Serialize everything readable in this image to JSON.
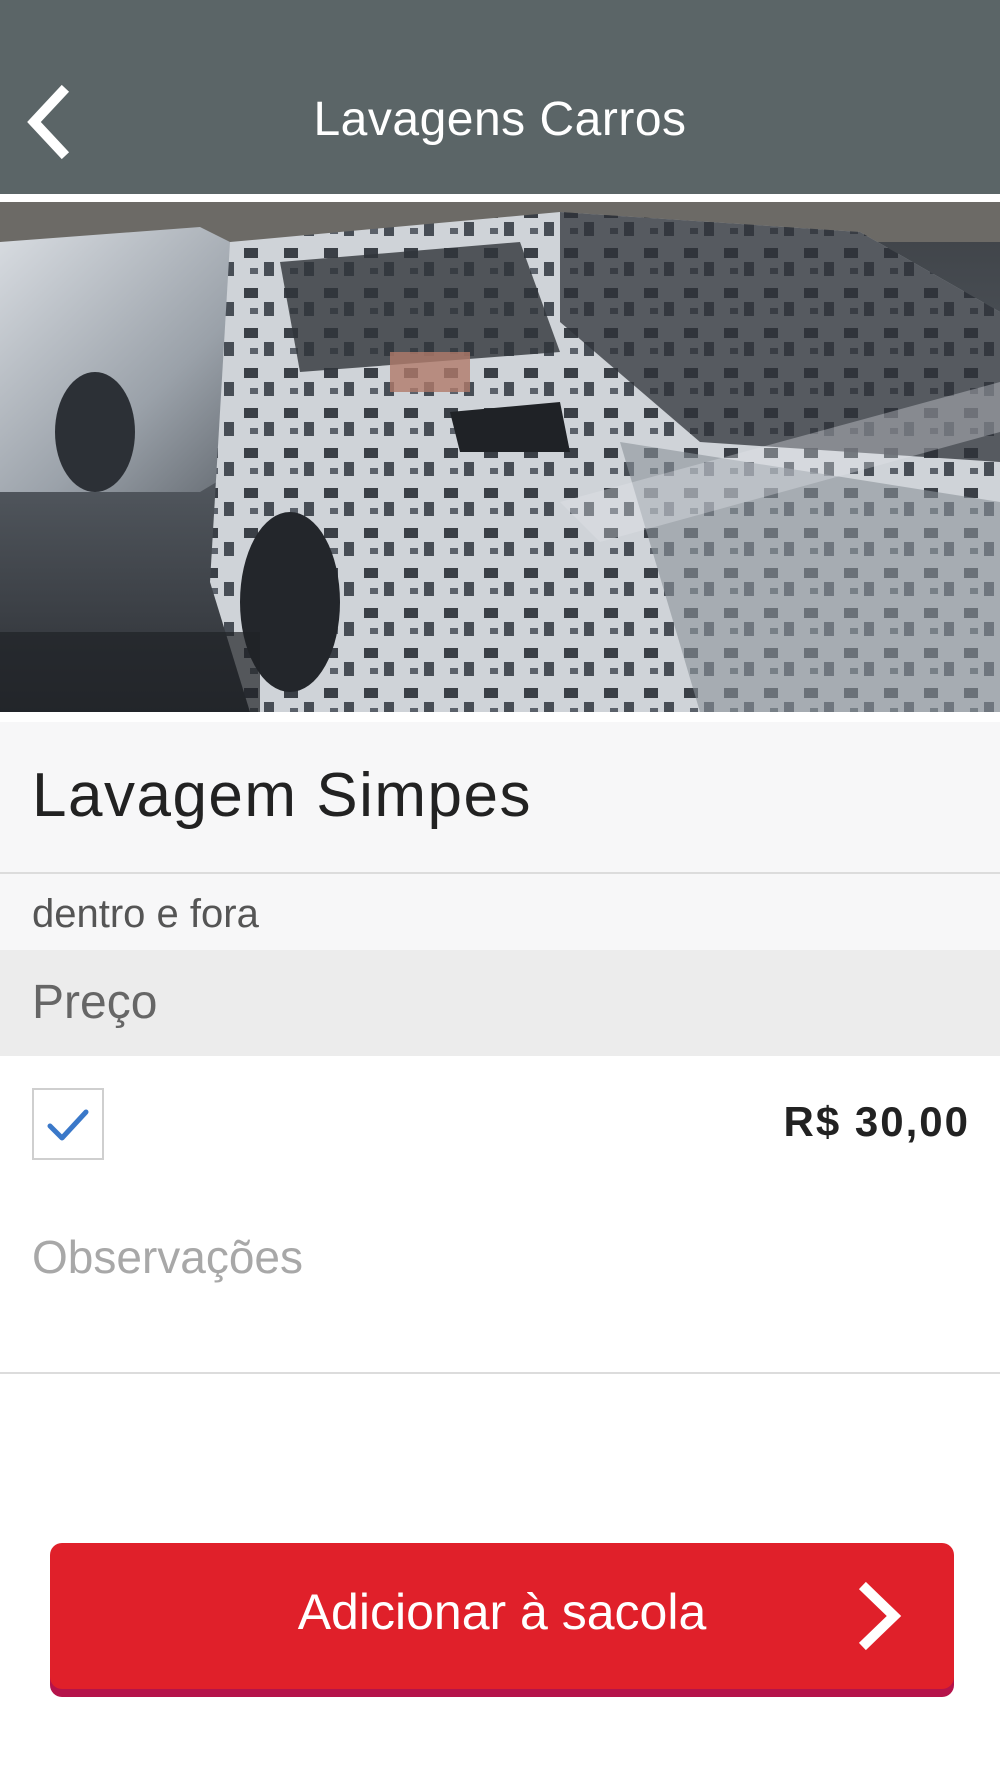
{
  "header": {
    "title": "Lavagens Carros",
    "back_icon": "chevron-left-icon"
  },
  "hero": {
    "image": "foam-covered-cars-photo"
  },
  "product": {
    "title": "Lavagem Simpes",
    "description": "dentro e fora"
  },
  "price_section": {
    "label": "Preço",
    "option": {
      "checked": true,
      "price": "R$ 30,00"
    }
  },
  "notes": {
    "placeholder": "Observações",
    "value": ""
  },
  "add_button": {
    "label": "Adicionar à sacola",
    "icon": "chevron-right-icon"
  },
  "colors": {
    "header_bg": "#5b6567",
    "accent_red": "#e0202a",
    "check_blue": "#3a78c9"
  }
}
